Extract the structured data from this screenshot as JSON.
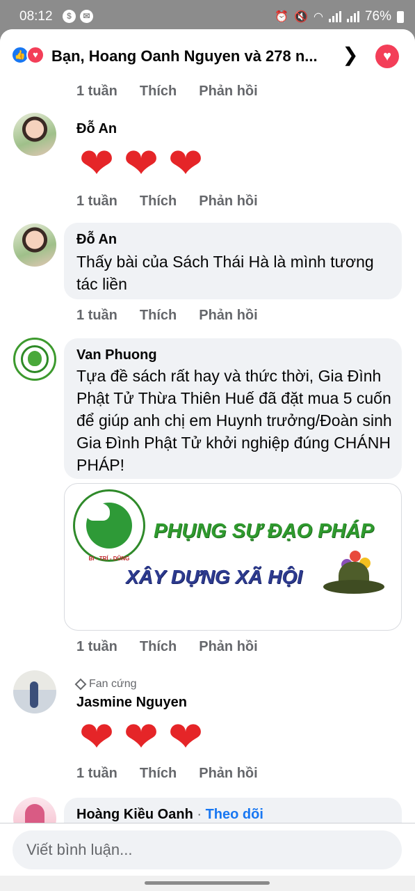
{
  "status_bar": {
    "time": "08:12",
    "battery": "76%"
  },
  "header": {
    "reactors": "Bạn, Hoang Oanh Nguyen và 278 n..."
  },
  "actions_common": {
    "time": "1 tuần",
    "like": "Thích",
    "reply": "Phản hồi"
  },
  "comments": [
    {
      "author": "Đỗ An",
      "type": "emoji",
      "emoji": [
        "❤",
        "❤",
        "❤"
      ]
    },
    {
      "author": "Đỗ An",
      "type": "text",
      "text": "Thấy bài của Sách Thái Hà là mình tương tác liền"
    },
    {
      "author": "Van Phuong",
      "type": "text_image",
      "text": "Tựa đề sách rất hay và thức thời, Gia Đình Phật Tử Thừa Thiên Huế đã đặt mua 5 cuốn để giúp anh chị em Huynh trưởng/Đoàn sinh Gia Đình Phật Tử khởi nghiệp đúng CHÁNH PHÁP!",
      "image": {
        "logo_text": "BI - TRÍ - DŨNG",
        "line1": "PHỤNG SỰ ĐẠO PHÁP",
        "line2": "XÂY DỰNG XÃ HỘI"
      }
    },
    {
      "author": "Jasmine Nguyen",
      "badge": "Fan cứng",
      "type": "emoji",
      "emoji": [
        "❤",
        "❤",
        "❤"
      ]
    },
    {
      "author": "Hoàng Kiều Oanh",
      "follow_label": "Theo dõi",
      "type": "partial"
    }
  ],
  "composer": {
    "placeholder": "Viết bình luận..."
  },
  "colors": {
    "accent": "#1877f2",
    "heart": "#f33e58",
    "bubble": "#f0f2f5",
    "muted": "#65676b"
  },
  "icons": [
    "like-reaction-icon",
    "love-reaction-icon",
    "chevron-right-icon",
    "love-button-icon",
    "diamond-icon"
  ]
}
